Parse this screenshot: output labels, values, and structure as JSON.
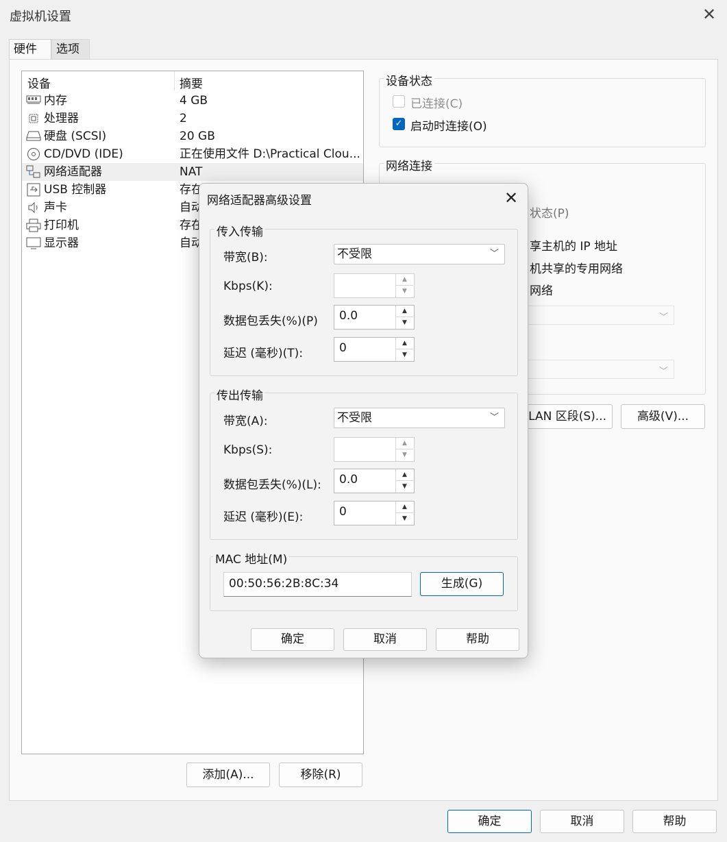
{
  "window": {
    "title": "虚拟机设置"
  },
  "tabs": [
    {
      "label": "硬件",
      "active": true
    },
    {
      "label": "选项",
      "active": false
    }
  ],
  "device_list": {
    "headers": {
      "device": "设备",
      "summary": "摘要"
    },
    "items": [
      {
        "icon": "memory-icon",
        "name": "内存",
        "summary": "4 GB"
      },
      {
        "icon": "processor-icon",
        "name": "处理器",
        "summary": "2"
      },
      {
        "icon": "harddisk-icon",
        "name": "硬盘 (SCSI)",
        "summary": "20 GB"
      },
      {
        "icon": "cd-dvd-icon",
        "name": "CD/DVD (IDE)",
        "summary": "正在使用文件 D:\\Practical Clou..."
      },
      {
        "icon": "network-adapter-icon",
        "name": "网络适配器",
        "summary": "NAT",
        "selected": true
      },
      {
        "icon": "usb-icon",
        "name": "USB 控制器",
        "summary": "存在"
      },
      {
        "icon": "sound-card-icon",
        "name": "声卡",
        "summary": "自动"
      },
      {
        "icon": "printer-icon",
        "name": "打印机",
        "summary": "存在"
      },
      {
        "icon": "display-icon",
        "name": "显示器",
        "summary": "自动"
      }
    ],
    "add_button": "添加(A)...",
    "remove_button": "移除(R)"
  },
  "device_status": {
    "title": "设备状态",
    "connected": {
      "label": "已连接(C)",
      "checked": false,
      "disabled": true
    },
    "connect_at_power_on": {
      "label": "启动时连接(O)",
      "checked": true
    }
  },
  "network_connection": {
    "title": "网络连接",
    "option_bridged_partial": "状态(P)",
    "option_nat_partial": "享主机的 IP 地址",
    "option_hostonly_partial": "机共享的专用网络",
    "option_custom_partial": "网络",
    "lan_segments_button": "LAN 区段(S)...",
    "advanced_button": "高级(V)..."
  },
  "dialog": {
    "title": "网络适配器高级设置",
    "incoming": {
      "title": "传入传输",
      "bandwidth_label": "带宽(B):",
      "bandwidth_value": "不受限",
      "kbps_label": "Kbps(K):",
      "kbps_value": "",
      "loss_label": "数据包丢失(%)(P)",
      "loss_value": "0.0",
      "latency_label": "延迟 (毫秒)(T):",
      "latency_value": "0"
    },
    "outgoing": {
      "title": "传出传输",
      "bandwidth_label": "带宽(A):",
      "bandwidth_value": "不受限",
      "kbps_label": "Kbps(S):",
      "kbps_value": "",
      "loss_label": "数据包丢失(%)(L):",
      "loss_value": "0.0",
      "latency_label": "延迟 (毫秒)(E):",
      "latency_value": "0"
    },
    "mac": {
      "title": "MAC 地址(M)",
      "value": "00:50:56:2B:8C:34",
      "generate_button": "生成(G)"
    },
    "ok_button": "确定",
    "cancel_button": "取消",
    "help_button": "帮助"
  },
  "footer": {
    "ok_button": "确定",
    "cancel_button": "取消",
    "help_button": "帮助"
  }
}
